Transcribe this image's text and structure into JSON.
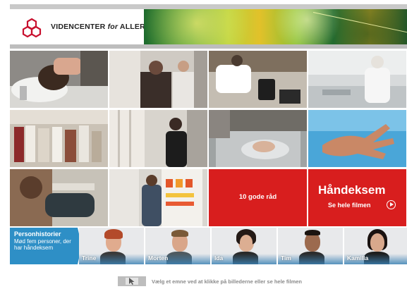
{
  "header": {
    "logo_text_part1": "VIDENCENTER ",
    "logo_text_for": "for",
    "logo_text_part2": " ALLERGI"
  },
  "tiles": {
    "advice_label": "10 gode råd",
    "film_title": "Håndeksem",
    "film_link": "Se hele filmen"
  },
  "people_section": {
    "title": "Personhistorier",
    "description": "Mød fem personer, der har håndeksem",
    "persons": [
      {
        "name": "Trine"
      },
      {
        "name": "Morten"
      },
      {
        "name": "Ida"
      },
      {
        "name": "Tim"
      },
      {
        "name": "Kamilla"
      }
    ]
  },
  "footer": {
    "hint": "Vælg et emne ved at klikke på billederne eller se hele filmen"
  },
  "colors": {
    "accent_red": "#d81e1e",
    "accent_blue": "#2e8fc6"
  }
}
